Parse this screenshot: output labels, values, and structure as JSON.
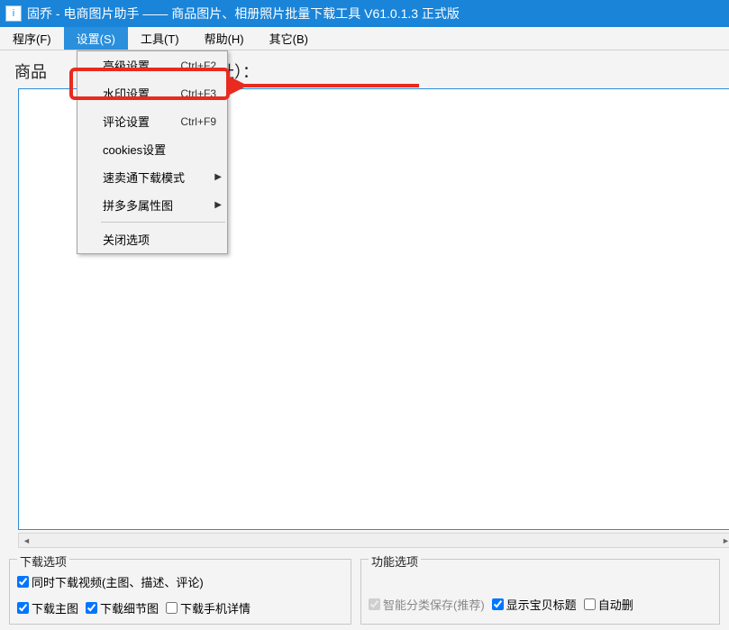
{
  "window": {
    "title": "固乔 - 电商图片助手 —— 商品图片、相册照片批量下载工具 V61.0.1.3 正式版",
    "icon_char": "i"
  },
  "menubar": {
    "items": [
      {
        "label": "程序(F)"
      },
      {
        "label": "设置(S)"
      },
      {
        "label": "工具(T)"
      },
      {
        "label": "帮助(H)"
      },
      {
        "label": "其它(B)"
      }
    ]
  },
  "page": {
    "label_prefix": "商品",
    "label_suffix_visible": "址）："
  },
  "dropdown": {
    "items": [
      {
        "label": "高级设置",
        "shortcut": "Ctrl+F2"
      },
      {
        "label": "水印设置",
        "shortcut": "Ctrl+F3"
      },
      {
        "label": "评论设置",
        "shortcut": "Ctrl+F9"
      },
      {
        "label": "cookies设置"
      },
      {
        "label": "速卖通下载模式",
        "submenu": true
      },
      {
        "label": "拼多多属性图",
        "submenu": true
      }
    ],
    "close_label": "关闭选项"
  },
  "bottom": {
    "download_group_title": "下载选项",
    "function_group_title": "功能选项",
    "chk_video_label": "同时下载视频(主图、描述、评论)",
    "chk_main_label": "下载主图",
    "chk_detail_label": "下载细节图",
    "chk_mobile_label": "下载手机详情",
    "chk_smart_label": "智能分类保存(推荐)",
    "chk_title_label": "显示宝贝标题",
    "chk_autodel_label": "自动删"
  }
}
